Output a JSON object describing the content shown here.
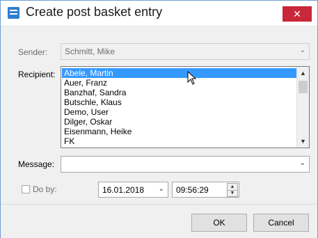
{
  "window": {
    "title": "Create post basket entry",
    "close_label": "✕"
  },
  "form": {
    "sender": {
      "label": "Sender:",
      "value": "Schmitt, Mike",
      "arrow": "⌄"
    },
    "recipient": {
      "label": "Recipient:",
      "items": [
        "Abele, Martin",
        "Auer, Franz",
        "Banzhaf, Sandra",
        "Butschle, Klaus",
        "Demo, User",
        "Dilger, Oskar",
        "Eisenmann, Heike",
        "FK"
      ],
      "selected_index": 0
    },
    "message": {
      "label": "Message:",
      "value": "",
      "arrow": "⌄"
    },
    "do_by": {
      "label": "Do by:",
      "checked": false,
      "date": "16.01.2018",
      "time": "09:56:29",
      "date_arrow": "⌄"
    }
  },
  "buttons": {
    "ok_label": "OK",
    "cancel_label": "Cancel"
  },
  "icons": {
    "app": "app-icon",
    "close": "close-icon",
    "scroll_up": "▲",
    "scroll_down": "▼",
    "spin_up": "▲",
    "spin_down": "▼"
  },
  "colors": {
    "accent": "#3399ff",
    "close_button": "#c8283a",
    "window_border": "#6e9fd4"
  }
}
